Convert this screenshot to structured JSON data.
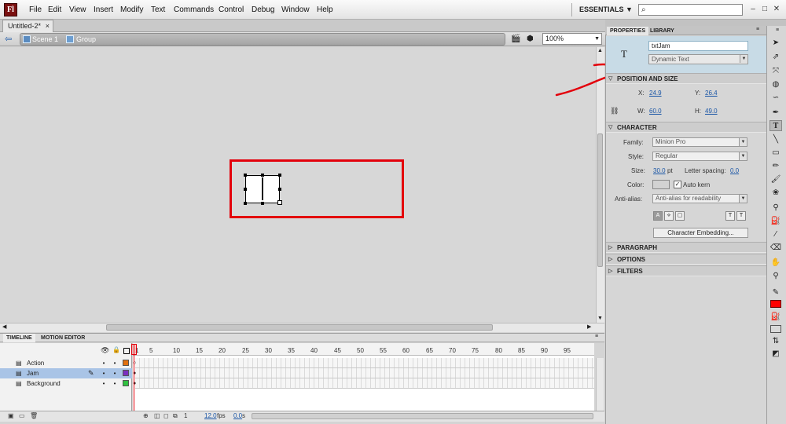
{
  "menubar": {
    "logo": "Fl",
    "items": [
      "File",
      "Edit",
      "View",
      "Insert",
      "Modify",
      "Text",
      "Commands",
      "Control",
      "Debug",
      "Window",
      "Help"
    ],
    "workspace": "ESSENTIALS",
    "search_value": "",
    "window_buttons": [
      "–",
      "□",
      "✕"
    ]
  },
  "document": {
    "tab": "Untitled-2*",
    "tab_close": "×",
    "breadcrumbs": [
      "Scene 1",
      "Group"
    ],
    "zoom": "100%"
  },
  "timeline": {
    "tabs": [
      "TIMELINE",
      "MOTION EDITOR"
    ],
    "frame_numbers": [
      "1",
      "5",
      "10",
      "15",
      "20",
      "25",
      "30",
      "35",
      "40",
      "45",
      "50",
      "55",
      "60",
      "65",
      "70",
      "75",
      "80",
      "85",
      "90",
      "95"
    ],
    "layers": [
      {
        "name": "Action",
        "color": "#e07010",
        "selected": false
      },
      {
        "name": "Jam",
        "color": "#7a30c0",
        "selected": true
      },
      {
        "name": "Background",
        "color": "#30c040",
        "selected": false
      }
    ],
    "status": {
      "frame": "1",
      "fps": "12.0",
      "fps_unit": "fps",
      "time": "0.0",
      "time_unit": "s"
    }
  },
  "properties": {
    "tabs": [
      "PROPERTIES",
      "LIBRARY"
    ],
    "instance_name": "txtJam",
    "text_type": "Dynamic Text",
    "sections": {
      "position": "POSITION AND SIZE",
      "character": "CHARACTER",
      "paragraph": "PARAGRAPH",
      "options": "OPTIONS",
      "filters": "FILTERS"
    },
    "position": {
      "x_label": "X:",
      "x": "24.9",
      "y_label": "Y:",
      "y": "26.4",
      "w_label": "W:",
      "w": "60.0",
      "h_label": "H:",
      "h": "49.0"
    },
    "character": {
      "family_label": "Family:",
      "family": "Minion Pro",
      "style_label": "Style:",
      "style": "Regular",
      "size_label": "Size:",
      "size": "30.0",
      "size_unit": "pt",
      "spacing_label": "Letter spacing:",
      "spacing": "0.0",
      "color_label": "Color:",
      "autokern": "Auto kern",
      "aa_label": "Anti-alias:",
      "aa": "Anti-alias for readability",
      "embedding": "Character Embedding..."
    }
  },
  "colors": {
    "accent_red": "#e3000b",
    "fill_color": "#ff0000"
  }
}
